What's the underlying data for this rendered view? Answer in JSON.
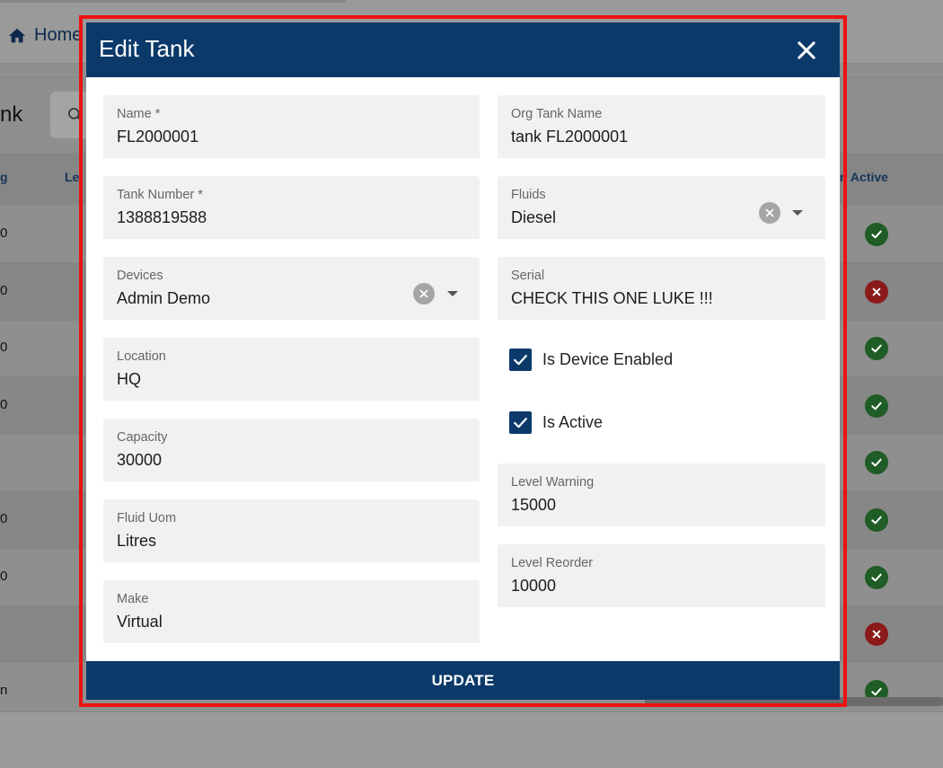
{
  "background": {
    "breadcrumb_home": "Home",
    "page_title_fragment": "nk",
    "columns": [
      {
        "label": "g"
      },
      {
        "label": "Le"
      },
      {
        "label": "n Active"
      }
    ],
    "rows": [
      {
        "first": "0",
        "status": "ok"
      },
      {
        "first": "0",
        "status": "bad"
      },
      {
        "first": "0",
        "status": "ok"
      },
      {
        "first": "0",
        "status": "ok"
      },
      {
        "first": "",
        "status": "ok"
      },
      {
        "first": "0",
        "status": "ok"
      },
      {
        "first": "0",
        "status": "ok"
      },
      {
        "first": "",
        "status": "bad"
      },
      {
        "first": "n",
        "status": "ok"
      }
    ],
    "icons": {
      "home": "home-icon",
      "search": "search-icon"
    }
  },
  "dialog": {
    "title": "Edit Tank",
    "close_icon": "close-icon",
    "fields": {
      "name": {
        "label": "Name *",
        "value": "FL2000001"
      },
      "org_tank_name": {
        "label": "Org Tank Name",
        "value": "tank FL2000001"
      },
      "tank_number": {
        "label": "Tank Number *",
        "value": "1388819588"
      },
      "fluids": {
        "label": "Fluids",
        "value": "Diesel"
      },
      "devices": {
        "label": "Devices",
        "value": "Admin Demo"
      },
      "serial": {
        "label": "Serial",
        "value": "CHECK THIS ONE LUKE !!!"
      },
      "location": {
        "label": "Location",
        "value": "HQ"
      },
      "capacity": {
        "label": "Capacity",
        "value": "30000"
      },
      "fluid_uom": {
        "label": "Fluid Uom",
        "value": "Litres"
      },
      "make": {
        "label": "Make",
        "value": "Virtual"
      },
      "level_warning": {
        "label": "Level Warning",
        "value": "15000"
      },
      "level_reorder": {
        "label": "Level Reorder",
        "value": "10000"
      }
    },
    "checkboxes": {
      "is_device_enabled": {
        "label": "Is Device Enabled",
        "checked": true
      },
      "is_active": {
        "label": "Is Active",
        "checked": true
      }
    },
    "update_label": "UPDATE"
  },
  "colors": {
    "primary": "#0b3a6a",
    "highlight": "#ee1111",
    "status_ok": "#1f5c26",
    "status_bad": "#8b1a1a"
  }
}
